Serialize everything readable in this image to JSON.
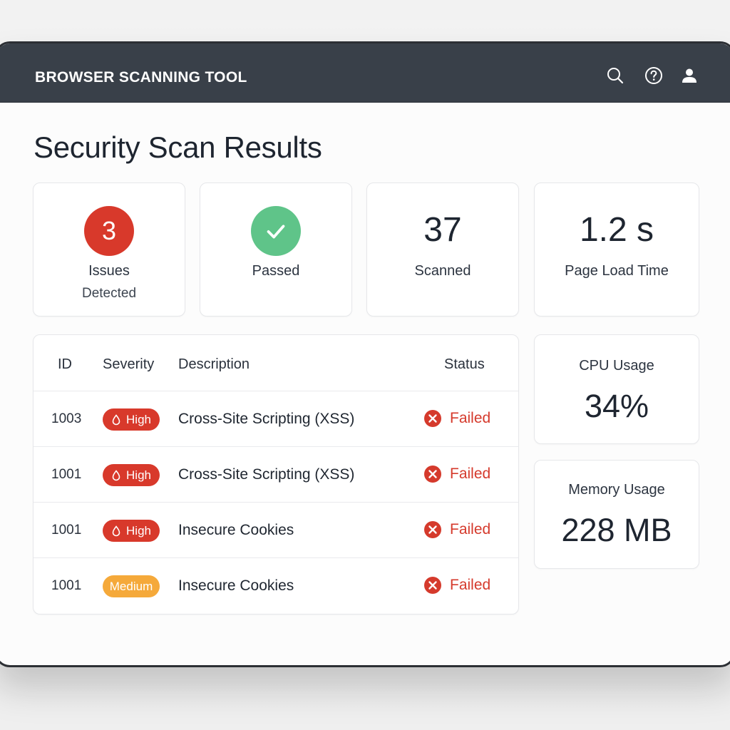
{
  "app": {
    "title": "BROWSER SCANNING TOOL"
  },
  "toolbar_icons": [
    "search-icon",
    "help-icon",
    "user-icon"
  ],
  "page": {
    "title": "Security Scan Results"
  },
  "stats": {
    "issues": {
      "count": "3",
      "label": "Issues",
      "sublabel": "Detected",
      "color": "#d8392b"
    },
    "passed": {
      "label": "Passed",
      "icon": "check-icon",
      "color": "#5fc489"
    },
    "scanned": {
      "value": "37",
      "label": "Scanned"
    },
    "load_time": {
      "value": "1.2 s",
      "label": "Page Load Time"
    }
  },
  "table": {
    "headers": {
      "id": "ID",
      "severity": "Severity",
      "description": "Description",
      "status": "Status"
    },
    "rows": [
      {
        "id": "1003",
        "severity": "High",
        "description": "Cross-Site Scripting (XSS)",
        "status": "Failed"
      },
      {
        "id": "1001",
        "severity": "High",
        "description": "Cross-Site Scripting (XSS)",
        "status": "Failed"
      },
      {
        "id": "1001",
        "severity": "High",
        "description": "Insecure Cookies",
        "status": "Failed"
      },
      {
        "id": "1001",
        "severity": "Medium",
        "description": "Insecure Cookies",
        "status": "Failed"
      }
    ]
  },
  "metrics": {
    "cpu": {
      "label": "CPU Usage",
      "value": "34%"
    },
    "memory": {
      "label": "Memory Usage",
      "value": "228 MB"
    }
  },
  "colors": {
    "topbar": "#394049",
    "high": "#d8392b",
    "medium": "#f5a93a",
    "failed": "#d53a2c",
    "passed": "#5fc489"
  }
}
